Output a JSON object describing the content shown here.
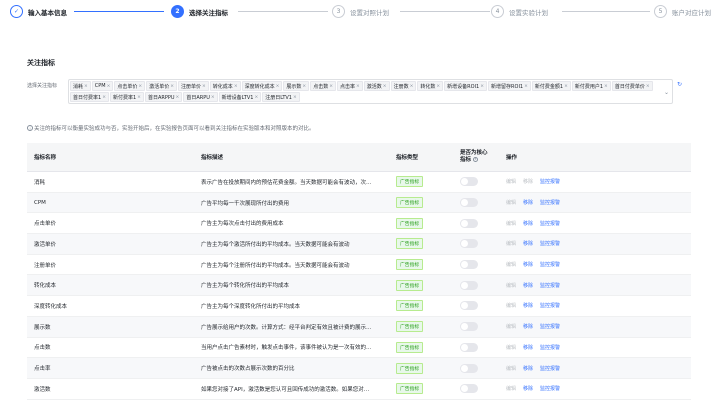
{
  "steps": [
    {
      "num": "✓",
      "label": "输入基本信息",
      "state": "done"
    },
    {
      "num": "2",
      "label": "选择关注指标",
      "state": "active"
    },
    {
      "num": "3",
      "label": "设置对照计划",
      "state": "todo"
    },
    {
      "num": "4",
      "label": "设置实验计划",
      "state": "todo"
    },
    {
      "num": "5",
      "label": "账户对应计划",
      "state": "todo"
    }
  ],
  "section_title": "关注指标",
  "select": {
    "label": "选择关注指标",
    "tags": [
      "消耗",
      "CPM",
      "点击单价",
      "激活单价",
      "注册单价",
      "转化成本",
      "深度转化成本",
      "展示数",
      "点击数",
      "点击率",
      "激活数",
      "注册数",
      "转化数",
      "新增设备ROI1",
      "新增留存ROI1",
      "新付费金额1",
      "新付费用户1",
      "首日付费单价",
      "首日付费率1",
      "新付费率1",
      "首日ARPPU",
      "首日ARPU",
      "新增设备LTV1",
      "注册日LTV1"
    ],
    "tag_close": "×"
  },
  "tip": "关注的指标可以衡量实验成功与否，实验开始后，在实验报告页面可以看到关注指标在实验版本和对照版本的对比。",
  "table": {
    "headers": {
      "name": "指标名称",
      "desc": "指标描述",
      "type": "指标类型",
      "core": "是否为核心\n指标",
      "ops": "操作"
    },
    "ops": {
      "edit": "编辑",
      "remove": "移除",
      "monitor": "监控报警"
    },
    "rows": [
      {
        "name": "消耗",
        "desc": "表示广告在投放期间内的预估花费金额。当天数据可能会有波动，次…",
        "type": "广告指标",
        "removable": false
      },
      {
        "name": "CPM",
        "desc": "广告平均每一千次展现所付出的费用",
        "type": "广告指标",
        "removable": true
      },
      {
        "name": "点击单价",
        "desc": "广告主为每次点击付出的费用成本",
        "type": "广告指标",
        "removable": true
      },
      {
        "name": "激活单价",
        "desc": "广告主为每个激活所付出的平均成本。当天数据可能会有波动",
        "type": "广告指标",
        "removable": true
      },
      {
        "name": "注册单价",
        "desc": "广告主为每个注册所付出的平均成本。当天数据可能会有波动",
        "type": "广告指标",
        "removable": true
      },
      {
        "name": "转化成本",
        "desc": "广告主为每个转化所付出的平均成本",
        "type": "广告指标",
        "removable": true
      },
      {
        "name": "深度转化成本",
        "desc": "广告主为每个深度转化所付出的平均成本",
        "type": "广告指标",
        "removable": true
      },
      {
        "name": "展示数",
        "desc": "广告展示给用户的次数。计算方式：经平台判定有效且被计费的展示…",
        "type": "广告指标",
        "removable": true
      },
      {
        "name": "点击数",
        "desc": "当用户点击广告素材时，触发点击事件，该事件被认为是一次有效的…",
        "type": "广告指标",
        "removable": true
      },
      {
        "name": "点击率",
        "desc": "广告被点击的次数占展示次数的百分比",
        "type": "广告指标",
        "removable": true
      },
      {
        "name": "激活数",
        "desc": "如果您对接了API，激活数是您认可且回传成功的激活数。如果您对…",
        "type": "广告指标",
        "removable": true
      }
    ]
  },
  "colors": {
    "primary": "#3370ff",
    "badge_green": "#2ea121"
  }
}
